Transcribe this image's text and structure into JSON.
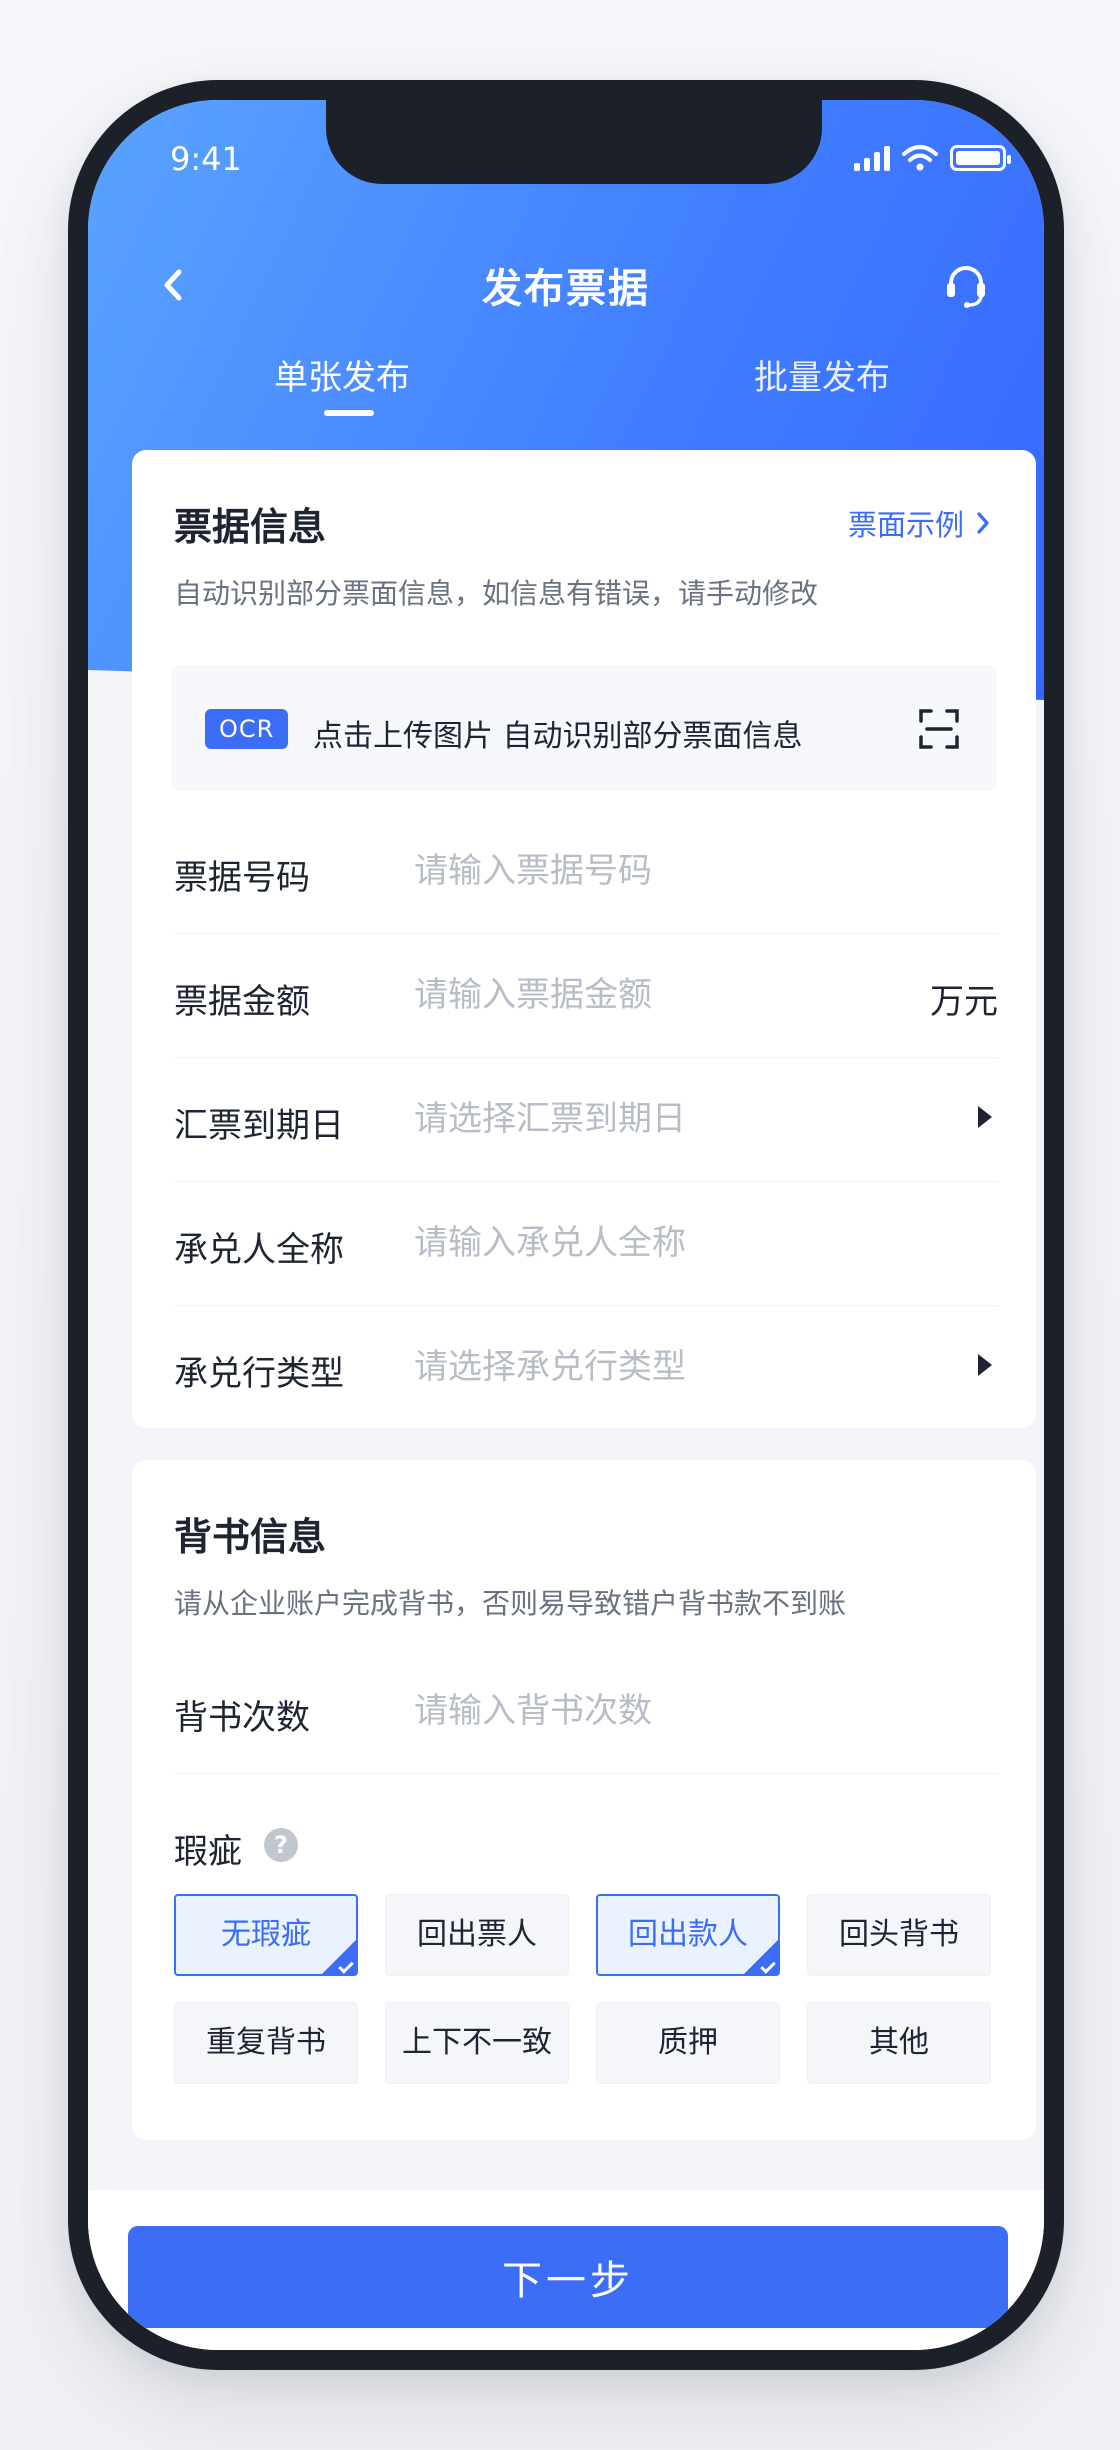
{
  "status_bar": {
    "time": "9:41",
    "icons": [
      "signal-icon",
      "wifi-icon",
      "battery-icon"
    ]
  },
  "navbar": {
    "title": "发布票据",
    "back_icon": "chevron-left-icon",
    "service_icon": "headset-icon"
  },
  "tabs": [
    {
      "label": "单张发布",
      "active": true
    },
    {
      "label": "批量发布",
      "active": false
    }
  ],
  "bill_info": {
    "title": "票据信息",
    "sample_link": "票面示例",
    "subtitle": "自动识别部分票面信息，如信息有错误，请手动修改",
    "ocr": {
      "tag": "OCR",
      "text": "点击上传图片 自动识别部分票面信息"
    },
    "fields": [
      {
        "label": "票据号码",
        "placeholder": "请输入票据号码",
        "value": ""
      },
      {
        "label": "票据金额",
        "placeholder": "请输入票据金额",
        "value": "",
        "unit": "万元"
      },
      {
        "label": "汇票到期日",
        "placeholder": "请选择汇票到期日",
        "value": ""
      },
      {
        "label": "承兑人全称",
        "placeholder": "请输入承兑人全称",
        "value": ""
      },
      {
        "label": "承兑行类型",
        "placeholder": "请选择承兑行类型",
        "value": ""
      }
    ]
  },
  "endorse_info": {
    "title": "背书信息",
    "subtitle": "请从企业账户完成背书，否则易导致错户背书款不到账",
    "count_field": {
      "label": "背书次数",
      "placeholder": "请输入背书次数",
      "value": ""
    },
    "flaw": {
      "label": "瑕疵",
      "help": "?",
      "options": [
        {
          "label": "无瑕疵",
          "selected": true
        },
        {
          "label": "回出票人",
          "selected": false
        },
        {
          "label": "回出款人",
          "selected": true
        },
        {
          "label": "回头背书",
          "selected": false
        },
        {
          "label": "重复背书",
          "selected": false
        },
        {
          "label": "上下不一致",
          "selected": false
        },
        {
          "label": "质押",
          "selected": false
        },
        {
          "label": "其他",
          "selected": false
        }
      ]
    }
  },
  "footer": {
    "next_label": "下一步"
  },
  "colors": {
    "primary": "#3b6df6",
    "hero_start": "#5aa3ff",
    "hero_end": "#3668ff",
    "text": "#1e2431",
    "placeholder": "#b7bcc6"
  }
}
